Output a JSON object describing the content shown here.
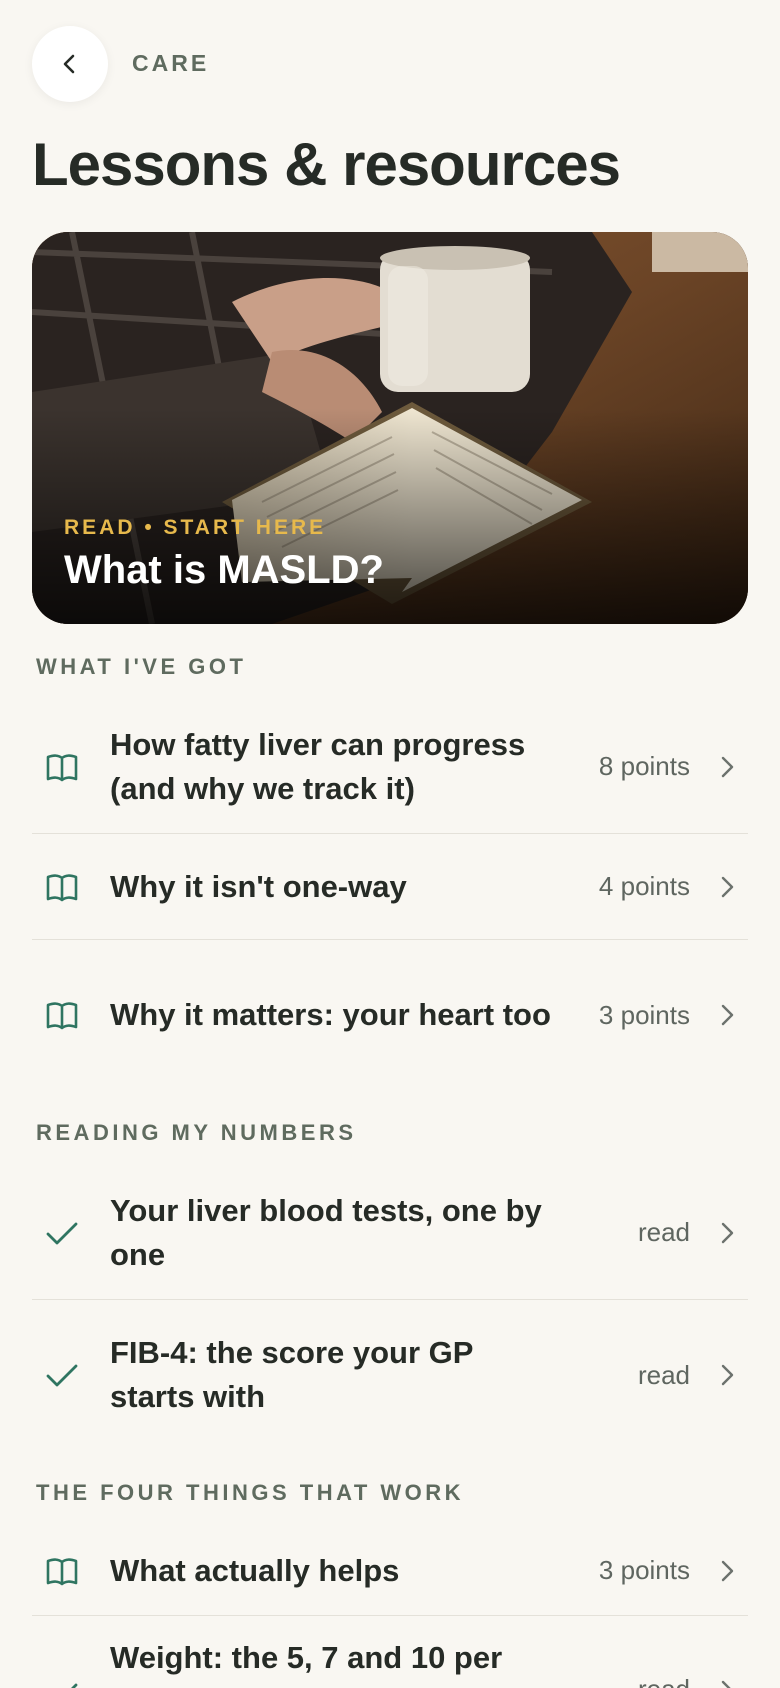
{
  "header": {
    "back_icon": "chevron-left-icon",
    "breadcrumb": "CARE",
    "title": "Lessons & resources"
  },
  "hero": {
    "kicker": "READ • START HERE",
    "title": "What is MASLD?",
    "image_alt_icon": "photo-coffee-book"
  },
  "sections": [
    {
      "label": "WHAT I'VE GOT",
      "items": [
        {
          "icon": "book-icon",
          "title": "How fatty liver can progress (and why we track it)",
          "meta": "8 points"
        },
        {
          "icon": "book-icon",
          "title": "Why it isn't one-way",
          "meta": "4 points"
        },
        {
          "icon": "book-icon",
          "title": "Why it matters: your heart too",
          "meta": "3 points"
        }
      ]
    },
    {
      "label": "READING MY NUMBERS",
      "items": [
        {
          "icon": "check-icon",
          "title": "Your liver blood tests, one by one",
          "meta": "read"
        },
        {
          "icon": "check-icon",
          "title": "FIB-4: the score your GP starts with",
          "meta": "read"
        }
      ]
    },
    {
      "label": "THE FOUR THINGS THAT WORK",
      "items": [
        {
          "icon": "book-icon",
          "title": "What actually helps",
          "meta": "3 points"
        },
        {
          "icon": "check-icon",
          "title": "Weight: the 5, 7 and 10 per",
          "meta": "read"
        }
      ]
    }
  ],
  "colors": {
    "background": "#f9f7f2",
    "accent_green": "#2f7561",
    "kicker_gold": "#e7b94c",
    "text_dark": "#262b26",
    "text_muted": "#5f6b5f"
  }
}
